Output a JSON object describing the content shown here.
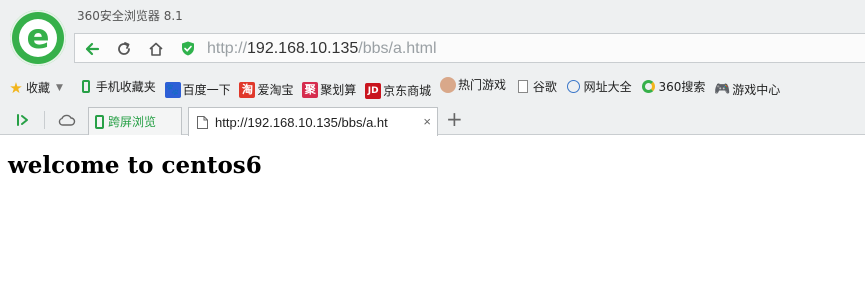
{
  "app": {
    "title": "360安全浏览器 8.1"
  },
  "address_bar": {
    "protocol": "http://",
    "host": "192.168.10.135",
    "path": "/bbs/a.html"
  },
  "bookmarks": [
    {
      "label": "收藏",
      "icon": "star-icon"
    },
    {
      "label": "手机收藏夹",
      "icon": "phone-icon"
    },
    {
      "label": "百度一下",
      "icon": "baidu-paw-icon"
    },
    {
      "label": "爱淘宝",
      "icon": "taobao-icon"
    },
    {
      "label": "聚划算",
      "icon": "juhuasuan-icon"
    },
    {
      "label": "京东商城",
      "icon": "jd-icon"
    },
    {
      "label": "热门游戏",
      "icon": "avatar-icon"
    },
    {
      "label": "谷歌",
      "icon": "page-icon"
    },
    {
      "label": "网址大全",
      "icon": "globe-icon"
    },
    {
      "label": "360搜索",
      "icon": "360-search-icon"
    },
    {
      "label": "游戏中心",
      "icon": "gamepad-icon"
    }
  ],
  "tabs": {
    "kuaping_label": "跨屏浏览",
    "active_tab_label": "http://192.168.10.135/bbs/a.ht",
    "close_glyph": "×",
    "new_tab_glyph": "+"
  },
  "page": {
    "heading": "welcome to centos6"
  },
  "colors": {
    "brand_green": "#36b04a",
    "chrome_bg": "#eef0f1",
    "url_gray": "#9aa0a4",
    "jd_red": "#c9151e",
    "taobao_red": "#e0382a"
  }
}
